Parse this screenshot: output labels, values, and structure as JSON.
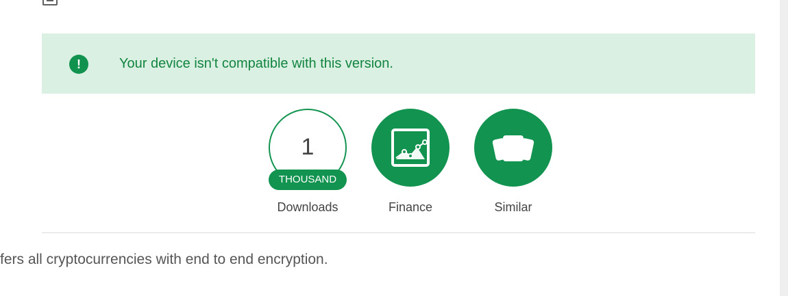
{
  "notice": {
    "icon": "exclamation-icon",
    "text": "Your device isn't compatible with this version.",
    "background_color": "#d9f0e3",
    "text_color": "#12843f"
  },
  "stats": {
    "downloads": {
      "count": "1",
      "unit": "THOUSAND",
      "label": "Downloads"
    },
    "category": {
      "icon": "image-chart-icon",
      "label": "Finance"
    },
    "similar": {
      "icon": "cards-icon",
      "label": "Similar"
    }
  },
  "description": {
    "text": "fers all cryptocurrencies with end to end encryption."
  },
  "colors": {
    "accent": "#12934f",
    "divider": "#dddddd"
  }
}
